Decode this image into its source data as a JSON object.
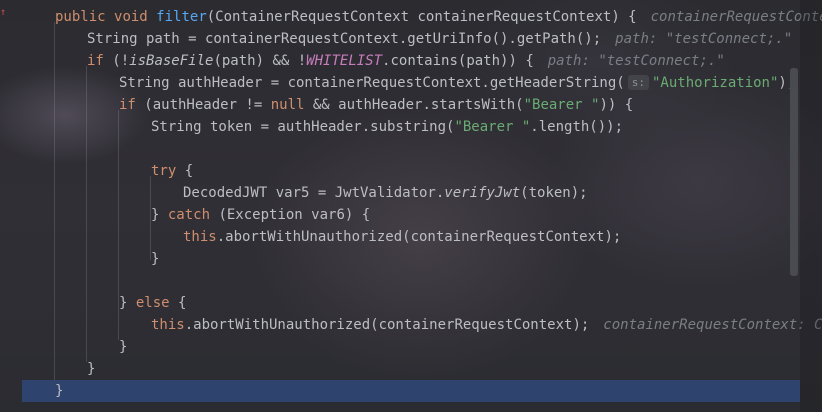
{
  "editor": {
    "gutter_marker": "↑",
    "lines": {
      "l1": {
        "kw1": "public",
        "kw2": "void",
        "fn": "filter",
        "rest": "(ContainerRequestContext containerRequestContext) {",
        "hint": "containerRequestContex"
      },
      "l2": {
        "code": "String path = containerRequestContext.getUriInfo().getPath();",
        "hint": "path: \"testConnect;.\""
      },
      "l3": {
        "kw": "if",
        "pre": " (!",
        "call": "isBaseFile",
        "mid": "(path) && !",
        "static": "WHITELIST",
        "post": ".contains(path)) {",
        "hint": "path: \"testConnect;.\""
      },
      "l4": {
        "code": "String authHeader = containerRequestContext.getHeaderString(",
        "badge": "s:",
        "str": "\"Authorization\"",
        "end": ");"
      },
      "l5": {
        "kw": "if",
        "pre": " (authHeader != ",
        "null": "null",
        "mid": " && authHeader.startsWith(",
        "str": "\"Bearer \"",
        "end": ")) {"
      },
      "l6": {
        "pre": "String token = authHeader.substring(",
        "str": "\"Bearer \"",
        "end": ".length());"
      },
      "l8": {
        "kw": "try",
        "end": " {"
      },
      "l9": {
        "pre": "DecodedJWT var5 = JwtValidator.",
        "call": "verifyJwt",
        "end": "(token);"
      },
      "l10": {
        "pre": "} ",
        "kw": "catch",
        "end": " (Exception var6) {"
      },
      "l11": {
        "kw": "this",
        "end": ".abortWithUnauthorized(containerRequestContext);"
      },
      "l12": {
        "code": "}"
      },
      "l14": {
        "pre": "} ",
        "kw": "else",
        "end": " {"
      },
      "l15": {
        "kw": "this",
        "end": ".abortWithUnauthorized(containerRequestContext);",
        "hint": "containerRequestContext: Co"
      },
      "l16": {
        "code": "}"
      },
      "l17": {
        "code": "}"
      },
      "l18": {
        "code": "}"
      }
    }
  },
  "colors": {
    "keyword": "#cf8e6d",
    "method": "#56a8f5",
    "string": "#6aab73",
    "static_field": "#c77dbb",
    "hint": "#7a7e85",
    "current_line": "#2e436e"
  }
}
